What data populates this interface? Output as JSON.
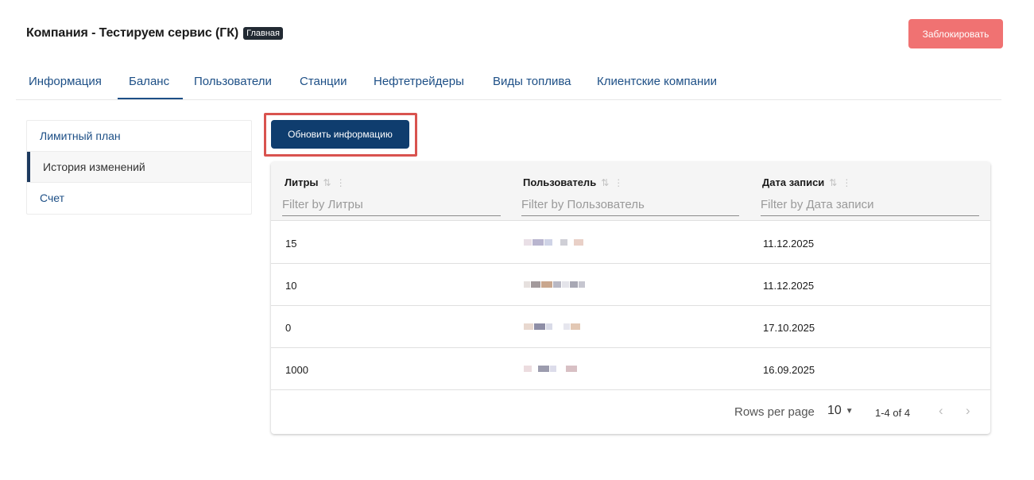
{
  "header": {
    "title": "Компания - Тестируем сервис (ГК)",
    "badge": "Главная",
    "block_button": "Заблокировать"
  },
  "tabs": [
    {
      "label": "Информация"
    },
    {
      "label": "Баланс",
      "active": true
    },
    {
      "label": "Пользователи"
    },
    {
      "label": "Станции"
    },
    {
      "label": "Нефтетрейдеры"
    },
    {
      "label": "Виды топлива"
    },
    {
      "label": "Клиентские компании"
    }
  ],
  "side_menu": [
    {
      "label": "Лимитный план"
    },
    {
      "label": "История изменений",
      "active": true
    },
    {
      "label": "Счет"
    }
  ],
  "refresh_button": "Обновить информацию",
  "table": {
    "columns": [
      {
        "title": "Литры",
        "filter_placeholder": "Filter by Литры"
      },
      {
        "title": "Пользователь",
        "filter_placeholder": "Filter by Пользователь"
      },
      {
        "title": "Дата записи",
        "filter_placeholder": "Filter by Дата записи"
      }
    ],
    "rows": [
      {
        "liters": "15",
        "date": "11.12.2025"
      },
      {
        "liters": "10",
        "date": "11.12.2025"
      },
      {
        "liters": "0",
        "date": "17.10.2025"
      },
      {
        "liters": "1000",
        "date": "16.09.2025"
      }
    ],
    "footer": {
      "rows_per_page_label": "Rows per page",
      "rows_per_page_value": "10",
      "range": "1-4 of 4"
    }
  },
  "icons": {
    "sort": "sort-arrows-icon",
    "menu": "column-menu-icon",
    "dropdown": "chevron-down-icon",
    "prev": "chevron-left-icon",
    "next": "chevron-right-icon"
  },
  "colors": {
    "accent": "#1d4f86",
    "primary_button": "#0f3d6e",
    "danger_button": "#f07272",
    "highlight": "#d9534f"
  }
}
